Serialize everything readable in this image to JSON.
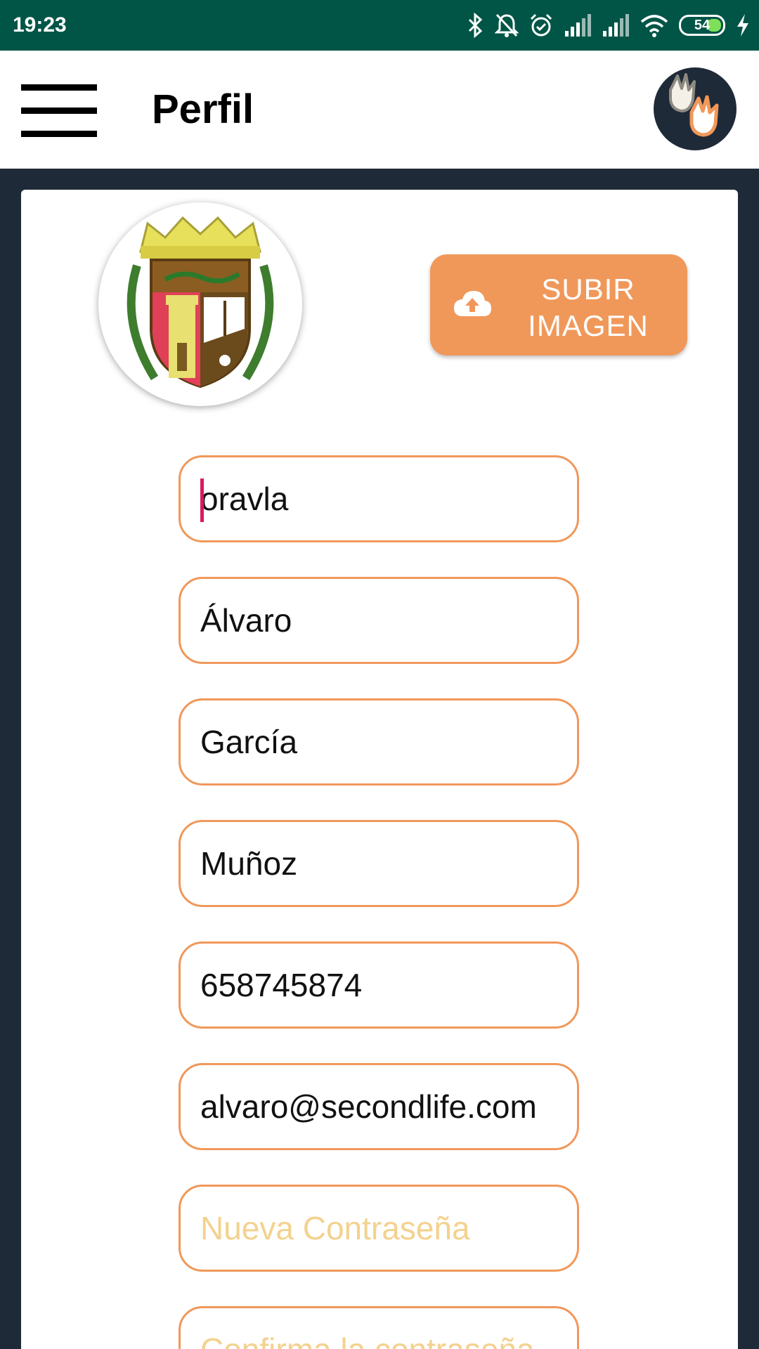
{
  "status_bar": {
    "time": "19:23",
    "battery_level": "54",
    "icons": [
      "bluetooth-icon",
      "notifications-off-icon",
      "alarm-icon",
      "signal-icon",
      "signal-icon",
      "wifi-icon",
      "battery-icon",
      "charging-icon"
    ]
  },
  "toolbar": {
    "menu_icon": "hamburger-menu-icon",
    "title": "Perfil",
    "logo": "hands-logo"
  },
  "profile": {
    "avatar": "crest-image",
    "upload_label": "SUBIR IMAGEN",
    "upload_icon": "cloud-upload-icon"
  },
  "form": {
    "username": "oravla",
    "first_name": "Álvaro",
    "last_name_1": "García",
    "last_name_2": "Muñoz",
    "phone": "658745874",
    "email": "alvaro@secondlife.com",
    "new_password_placeholder": "Nueva Contraseña",
    "confirm_password_placeholder": "Confirma la contraseña"
  },
  "colors": {
    "status_bar": "#005546",
    "accent": "#f0985a",
    "background": "#1f2a38",
    "placeholder": "#f3d28f",
    "cursor": "#d81b60"
  }
}
